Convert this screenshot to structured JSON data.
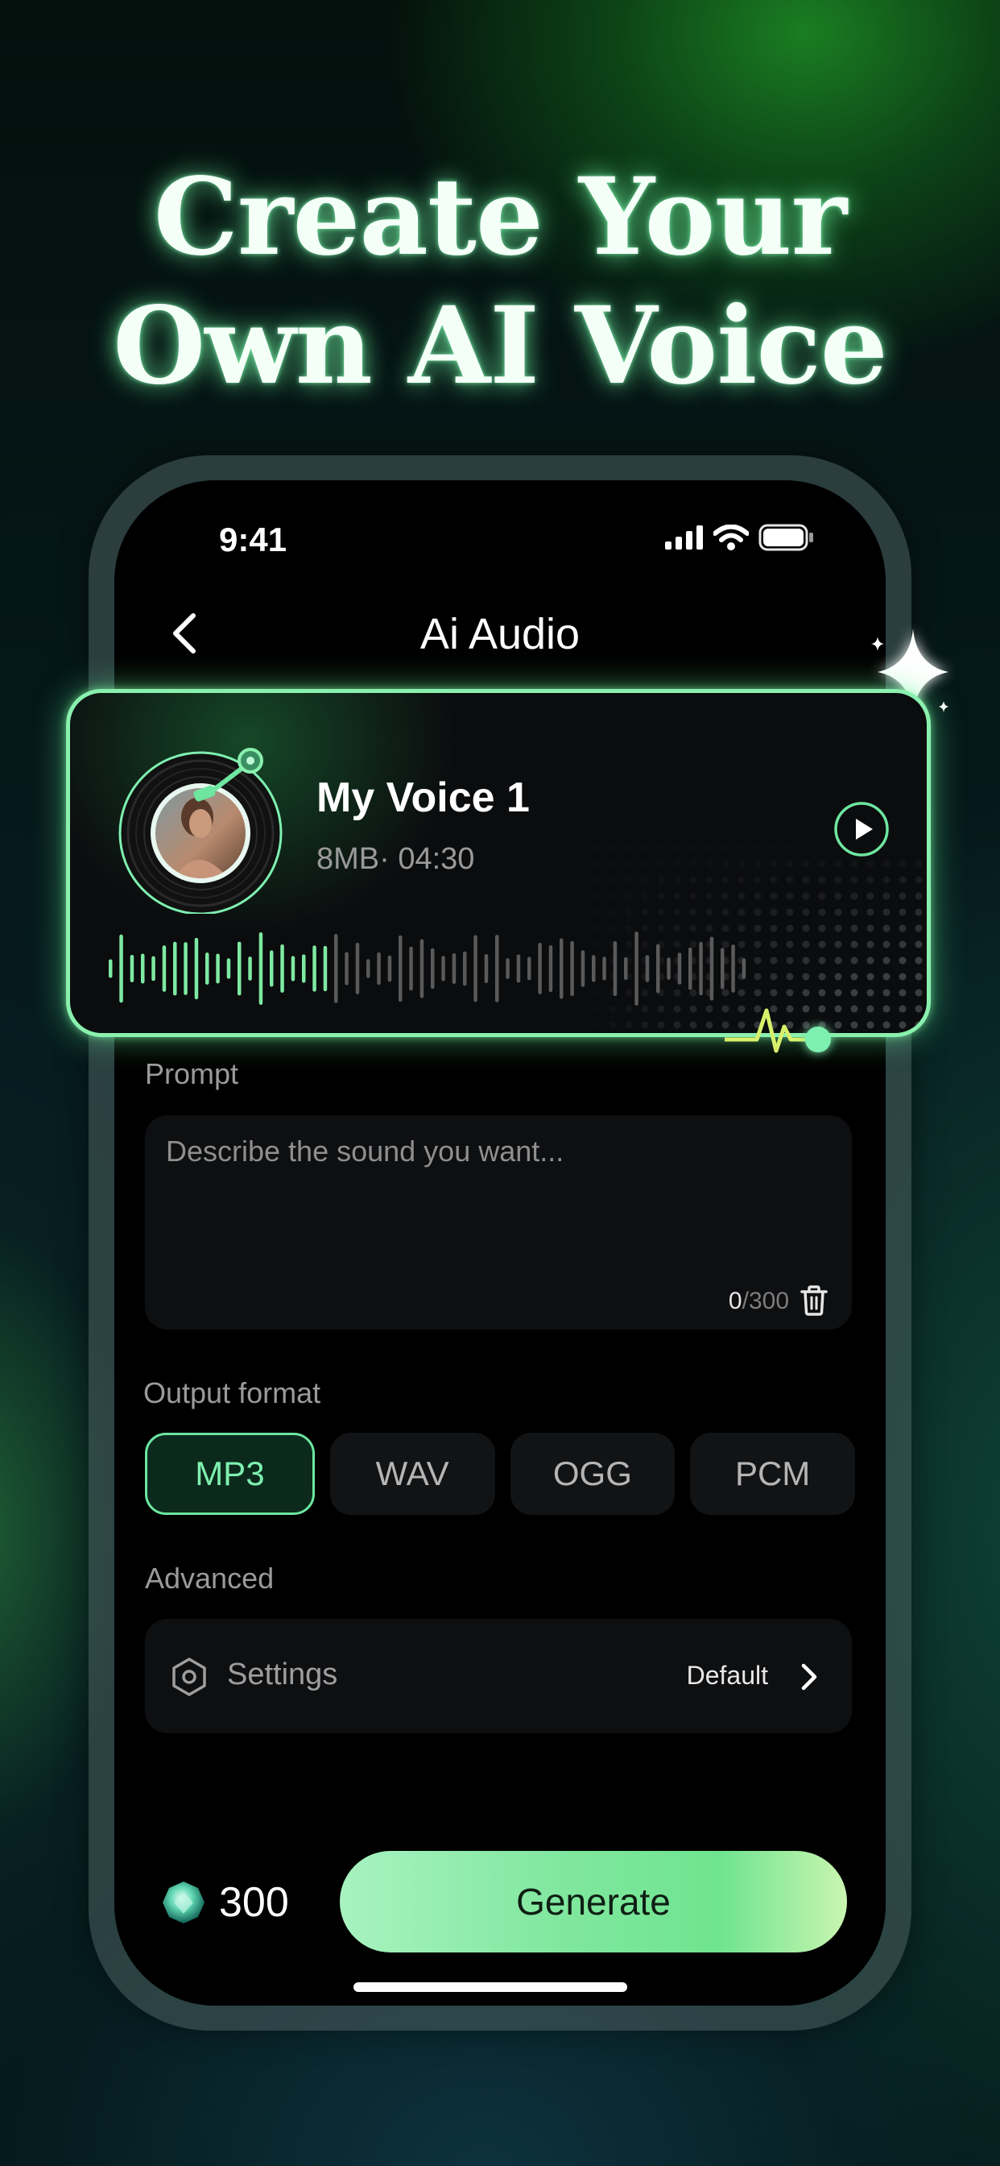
{
  "headline": {
    "line1": "Create Your",
    "line2": "Own AI Voice"
  },
  "status_bar": {
    "time": "9:41"
  },
  "nav": {
    "title": "Ai Audio"
  },
  "voice": {
    "name": "My Voice 1",
    "meta": "8MB· 04:30",
    "played_fraction": 0.35
  },
  "prompt": {
    "label": "Prompt",
    "placeholder": "Describe the sound you want...",
    "count": "0",
    "max": "/300"
  },
  "output": {
    "label": "Output format",
    "options": [
      "MP3",
      "WAV",
      "OGG",
      "PCM"
    ],
    "selected": "MP3"
  },
  "advanced": {
    "label": "Advanced",
    "settings_label": "Settings",
    "settings_value": "Default"
  },
  "footer": {
    "credits": "300",
    "generate_label": "Generate"
  },
  "colors": {
    "accent": "#7ee9a2",
    "background": "#000000",
    "card": "#0e0f11"
  }
}
